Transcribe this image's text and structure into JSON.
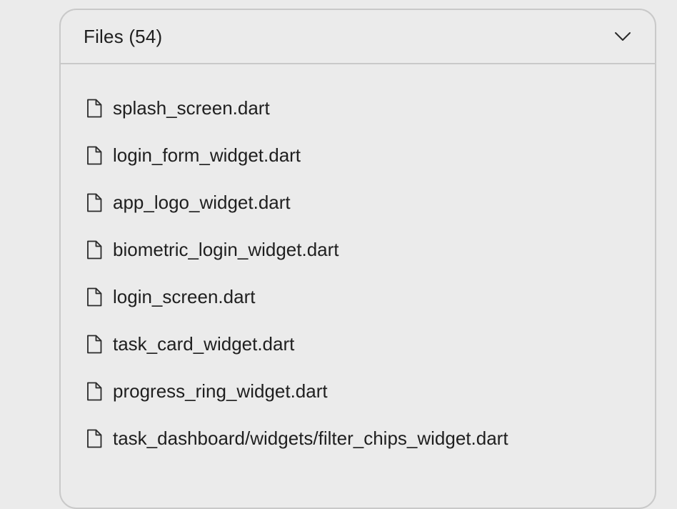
{
  "panel": {
    "title": "Files (54)",
    "toggle_icon": "chevron-down-icon",
    "file_icon": "file-icon",
    "files": [
      {
        "name": "splash_screen.dart"
      },
      {
        "name": "login_form_widget.dart"
      },
      {
        "name": "app_logo_widget.dart"
      },
      {
        "name": "biometric_login_widget.dart"
      },
      {
        "name": "login_screen.dart"
      },
      {
        "name": "task_card_widget.dart"
      },
      {
        "name": "progress_ring_widget.dart"
      },
      {
        "name": "task_dashboard/widgets/filter_chips_widget.dart"
      }
    ]
  },
  "colors": {
    "background": "#ebebeb",
    "border": "#c9c9c9",
    "text": "#1f1f1f"
  }
}
